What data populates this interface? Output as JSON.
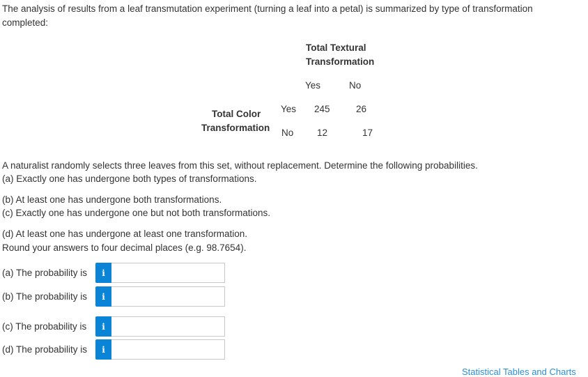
{
  "intro": "The analysis of results from a leaf transmutation experiment (turning a leaf into a petal) is summarized by type of transformation completed:",
  "table": {
    "col_header_line1": "Total Textural",
    "col_header_line2": "Transformation",
    "col_labels": [
      "Yes",
      "No"
    ],
    "row_header_line1": "Total Color",
    "row_header_line2": "Transformation",
    "rows": [
      {
        "label": "Yes",
        "values": [
          "245",
          "26"
        ]
      },
      {
        "label": "No",
        "values": [
          "12",
          "17"
        ]
      }
    ]
  },
  "problem": {
    "statement": "A naturalist randomly selects three leaves from this set, without replacement. Determine the following probabilities.",
    "parts": [
      "(a) Exactly one has undergone both types of transformations.",
      "(b) At least one has undergone both transformations.",
      "(c) Exactly one has undergone one but not both transformations.",
      "(d) At least one has undergone at least one transformation."
    ],
    "rounding": "Round your answers to four decimal places (e.g. 98.7654)."
  },
  "answers": [
    {
      "label": "(a) The probability is",
      "value": ""
    },
    {
      "label": "(b) The probability is",
      "value": ""
    },
    {
      "label": "(c) The probability is",
      "value": ""
    },
    {
      "label": "(d) The probability is",
      "value": ""
    }
  ],
  "info_glyph": "i",
  "footer_link": "Statistical Tables and Charts"
}
